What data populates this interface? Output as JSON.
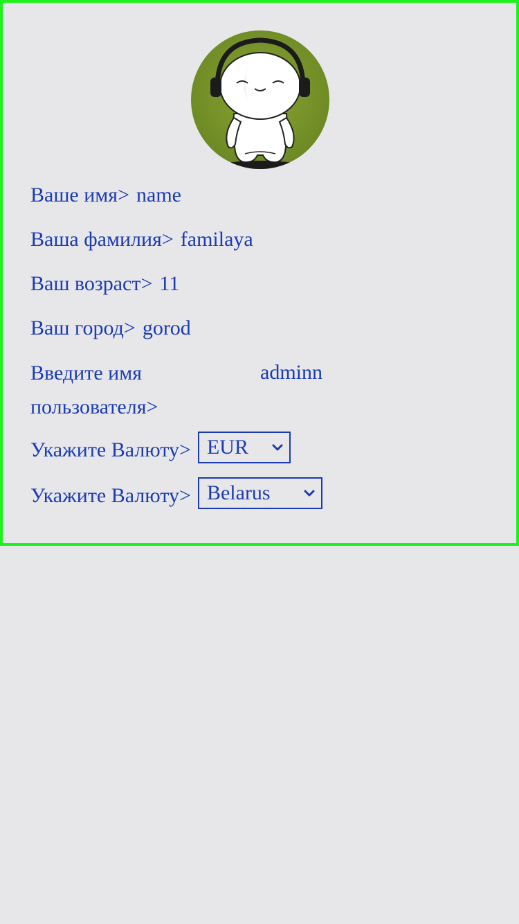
{
  "profile": {
    "avatar_icon": "avatar-headphones-character",
    "colors": {
      "text": "#1a3bb3",
      "frame": "#1ef21e",
      "background": "#e7e7ea"
    },
    "fields": [
      {
        "label": "Ваше имя>",
        "value": "name"
      },
      {
        "label": "Ваша фамилия>",
        "value": "familaya"
      },
      {
        "label": "Ваш возраст>",
        "value": "11"
      },
      {
        "label": "Ваш город>",
        "value": "gorod"
      },
      {
        "label": "Введите имя пользователя>",
        "value": "adminn"
      }
    ],
    "currency": {
      "label": "Укажите Валюту>",
      "selected": "EUR"
    },
    "country": {
      "label": "Укажите Валюту>",
      "selected": "Belarus"
    }
  }
}
